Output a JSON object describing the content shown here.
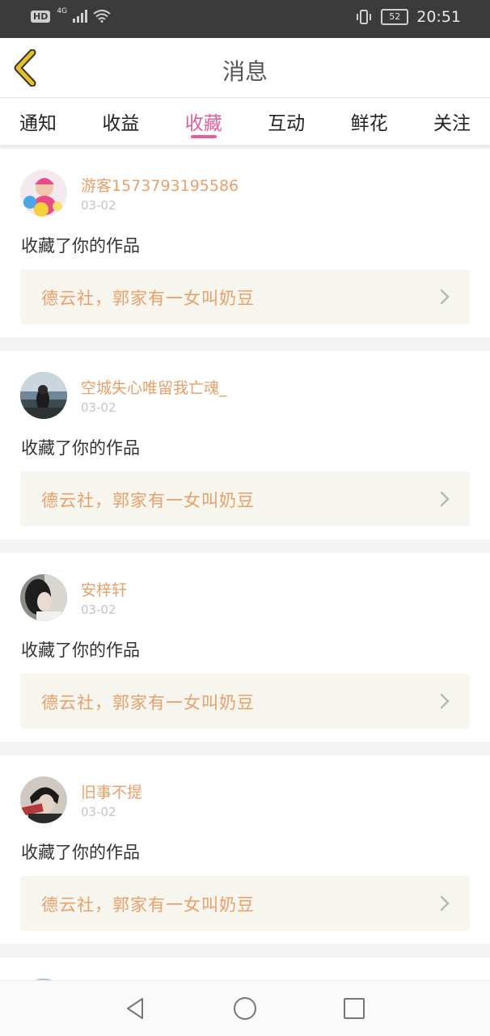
{
  "status_bar": {
    "left_label": "HD",
    "network_label": "4G",
    "battery": "52",
    "time": "20:51"
  },
  "header": {
    "title": "消息"
  },
  "tabs": [
    {
      "label": "通知",
      "active": false
    },
    {
      "label": "收益",
      "active": false
    },
    {
      "label": "收藏",
      "active": true
    },
    {
      "label": "互动",
      "active": false
    },
    {
      "label": "鲜花",
      "active": false
    },
    {
      "label": "关注",
      "active": false
    }
  ],
  "items": [
    {
      "username": "游客1573793195586",
      "date": "03-02",
      "action": "收藏了你的作品",
      "work_title": "德云社，郭家有一女叫奶豆"
    },
    {
      "username": "空城失心唯留我亡魂_",
      "date": "03-02",
      "action": "收藏了你的作品",
      "work_title": "德云社，郭家有一女叫奶豆"
    },
    {
      "username": "安梓轩",
      "date": "03-02",
      "action": "收藏了你的作品",
      "work_title": "德云社，郭家有一女叫奶豆"
    },
    {
      "username": "旧事不提",
      "date": "03-02",
      "action": "收藏了你的作品",
      "work_title": "德云社，郭家有一女叫奶豆"
    }
  ],
  "colors": {
    "accent": "#e25f9c",
    "name": "#e8a06b",
    "back_icon": "#e6c229"
  },
  "icons": [
    "back-icon",
    "chevron-right-icon",
    "nav-back-icon",
    "nav-home-icon",
    "nav-recents-icon",
    "wifi-icon",
    "signal-icon",
    "vibrate-icon",
    "battery-icon"
  ]
}
